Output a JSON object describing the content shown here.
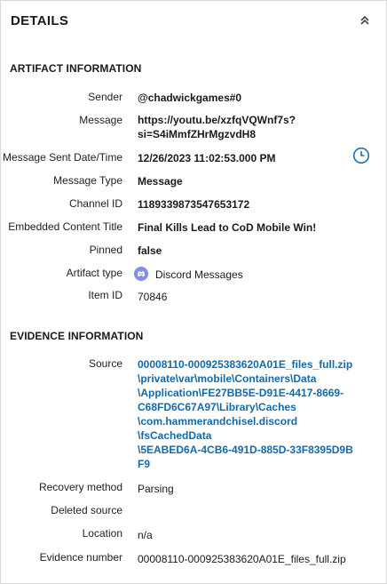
{
  "panel": {
    "title": "DETAILS"
  },
  "artifact_section": {
    "title": "ARTIFACT INFORMATION"
  },
  "artifact": {
    "sender_label": "Sender",
    "sender": "@chadwickgames#0",
    "message_label": "Message",
    "message_line1": "https://youtu.be/xzfqVQWnf7s?",
    "message_line2": "si=S4iMmfZHrMgzvdH8",
    "sent_label": "Message Sent Date/Time",
    "sent": "12/26/2023 11:02:53.000 PM",
    "type_label": "Message Type",
    "type": "Message",
    "channel_label": "Channel ID",
    "channel": "1189339873547653172",
    "embedded_label": "Embedded Content Title",
    "embedded": "Final Kills Lead to CoD Mobile Win!",
    "pinned_label": "Pinned",
    "pinned": "false",
    "artifact_type_label": "Artifact type",
    "artifact_type": "Discord Messages",
    "item_id_label": "Item ID",
    "item_id": "70846"
  },
  "evidence_section": {
    "title": "EVIDENCE INFORMATION"
  },
  "evidence": {
    "source_label": "Source",
    "source_lines": [
      "00008110-000925383620A01E_files_full.zip",
      "\\private\\var\\mobile\\Containers\\Data",
      "\\Application\\FE27BB5E-D91E-4417-8669-",
      "C68FD6C67A97\\Library\\Caches",
      "\\com.hammerandchisel.discord",
      "\\fsCachedData",
      "\\5EABED6A-4CB6-491D-885D-33F8395D9B",
      "F9"
    ],
    "recovery_label": "Recovery method",
    "recovery": "Parsing",
    "deleted_label": "Deleted source",
    "deleted": "",
    "location_label": "Location",
    "location": "n/a",
    "number_label": "Evidence number",
    "number": "00008110-000925383620A01E_files_full.zip"
  },
  "icons": {
    "collapse": "chevrons-up-icon",
    "clock": "clock-icon",
    "discord": "discord-icon"
  },
  "colors": {
    "link": "#1669a8",
    "accent": "#1f6fb5"
  }
}
